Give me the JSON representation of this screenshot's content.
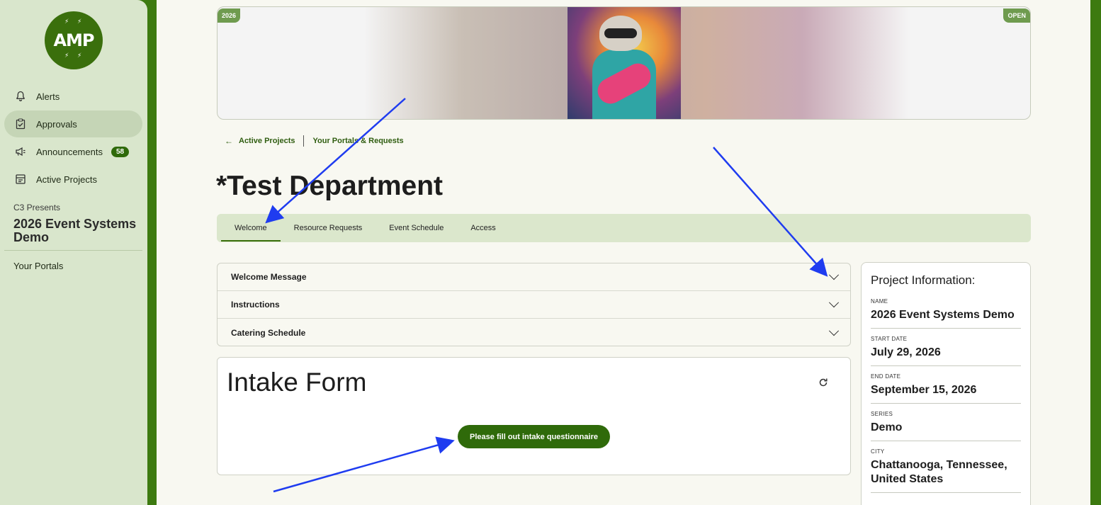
{
  "sidebar": {
    "logo_text": "AMP",
    "items": [
      {
        "label": "Alerts",
        "icon": "bell-icon"
      },
      {
        "label": "Approvals",
        "icon": "clipboard-check-icon",
        "active": true
      },
      {
        "label": "Announcements",
        "icon": "megaphone-icon",
        "badge": "58"
      },
      {
        "label": "Active Projects",
        "icon": "project-list-icon"
      }
    ],
    "org_name": "C3 Presents",
    "project_name": "2026 Event Systems Demo",
    "your_portals": "Your Portals"
  },
  "banner": {
    "year_tag": "2026",
    "status_tag": "OPEN"
  },
  "breadcrumb": {
    "back_label": "Active Projects",
    "portals_label": "Your Portals & Requests"
  },
  "page": {
    "title": "*Test Department"
  },
  "tabs": [
    {
      "label": "Welcome",
      "active": true
    },
    {
      "label": "Resource Requests"
    },
    {
      "label": "Event Schedule"
    },
    {
      "label": "Access"
    }
  ],
  "accordion": [
    {
      "label": "Welcome Message"
    },
    {
      "label": "Instructions"
    },
    {
      "label": "Catering Schedule"
    }
  ],
  "intake": {
    "title": "Intake Form",
    "button_label": "Please fill out intake questionnaire"
  },
  "project_info": {
    "heading": "Project Information:",
    "fields": [
      {
        "label": "NAME",
        "value": "2026 Event Systems Demo"
      },
      {
        "label": "START DATE",
        "value": "July 29, 2026"
      },
      {
        "label": "END DATE",
        "value": "September 15, 2026"
      },
      {
        "label": "SERIES",
        "value": "Demo"
      },
      {
        "label": "CITY",
        "value": "Chattanooga, Tennessee, United States"
      }
    ]
  },
  "colors": {
    "brand_green": "#2f6a0a",
    "sidebar_bg": "#d9e6cc",
    "annotation_arrow": "#1f3cf0"
  }
}
